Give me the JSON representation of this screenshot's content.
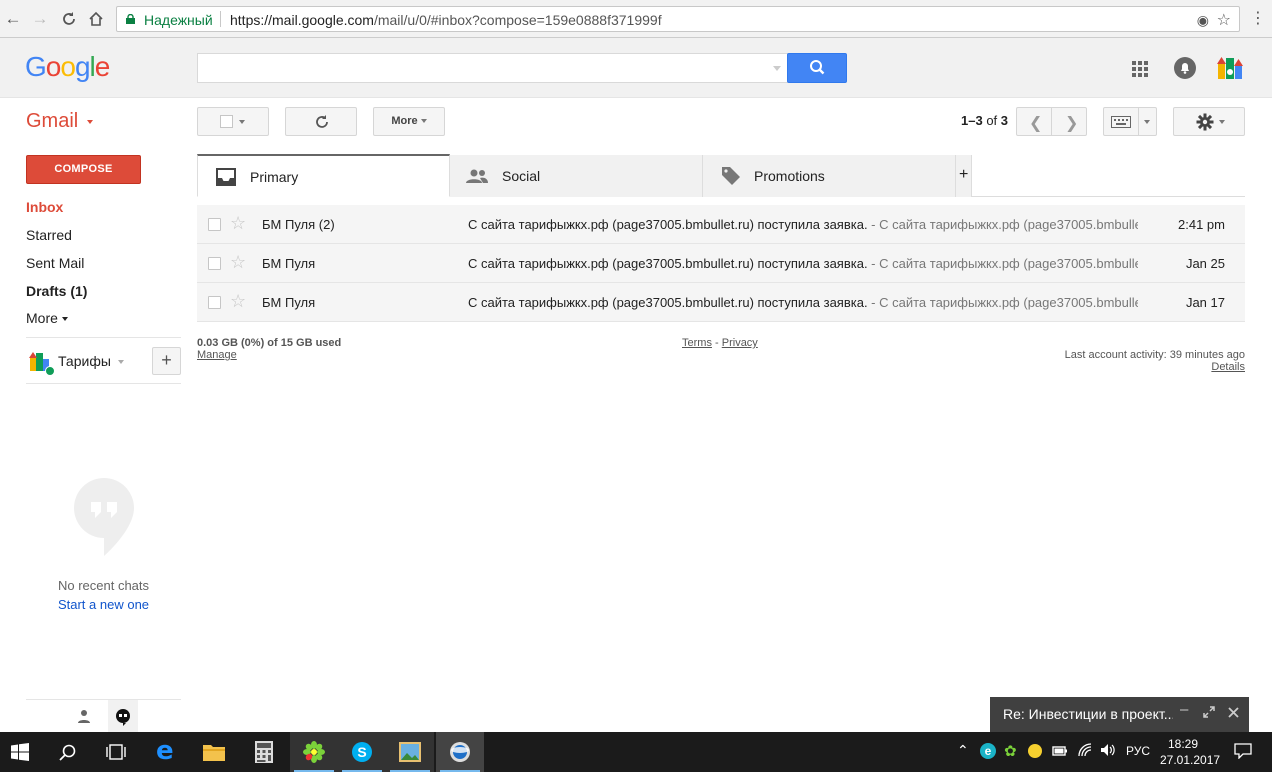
{
  "browser": {
    "secure_label": "Надежный",
    "url_host": "https://mail.google.com",
    "url_path": "/mail/u/0/#inbox?compose=159e0888f371999f"
  },
  "header": {
    "logo": "Google",
    "search_placeholder": ""
  },
  "toolbar": {
    "gmail_label": "Gmail",
    "more_label": "More",
    "pagination": "1–3 of 3",
    "pagination_range": "1–3",
    "pagination_of": "of",
    "pagination_total": "3"
  },
  "sidebar": {
    "compose_label": "COMPOSE",
    "items": [
      {
        "label": "Inbox"
      },
      {
        "label": "Starred"
      },
      {
        "label": "Sent Mail"
      },
      {
        "label": "Drafts (1)"
      },
      {
        "label": "More"
      }
    ],
    "hangouts_user": "Тарифы",
    "no_chats": "No recent chats",
    "start_new": "Start a new one"
  },
  "tabs": [
    {
      "label": "Primary"
    },
    {
      "label": "Social"
    },
    {
      "label": "Promotions"
    }
  ],
  "tab_add": "+",
  "messages": [
    {
      "sender": "БМ Пуля (2)",
      "subject": "С сайта тарифыжкх.рф (page37005.bmbullet.ru) поступила заявка.",
      "snippet": " - С сайта тарифыжкх.рф (page37005.bmbullet",
      "date": "2:41 pm"
    },
    {
      "sender": "БМ Пуля",
      "subject": "С сайта тарифыжкх.рф (page37005.bmbullet.ru) поступила заявка.",
      "snippet": " - С сайта тарифыжкх.рф (page37005.bmbullet",
      "date": "Jan 25"
    },
    {
      "sender": "БМ Пуля",
      "subject": "С сайта тарифыжкх.рф (page37005.bmbullet.ru) поступила заявка.",
      "snippet": " - С сайта тарифыжкх.рф (page37005.bmbullet",
      "date": "Jan 17"
    }
  ],
  "footer": {
    "storage": "0.03 GB (0%) of 15 GB used",
    "manage": "Manage",
    "terms": "Terms",
    "dash": "-",
    "privacy": "Privacy",
    "last_activity": "Last account activity: 39 minutes ago",
    "details": "Details"
  },
  "chat_popup": {
    "title": "Re: Инвестиции в проект..."
  },
  "taskbar": {
    "lang": "РУС",
    "time": "18:29",
    "date": "27.01.2017"
  },
  "colors": {
    "accent_red": "#dd4b39",
    "blue": "#4285f4",
    "link": "#1155cc"
  }
}
